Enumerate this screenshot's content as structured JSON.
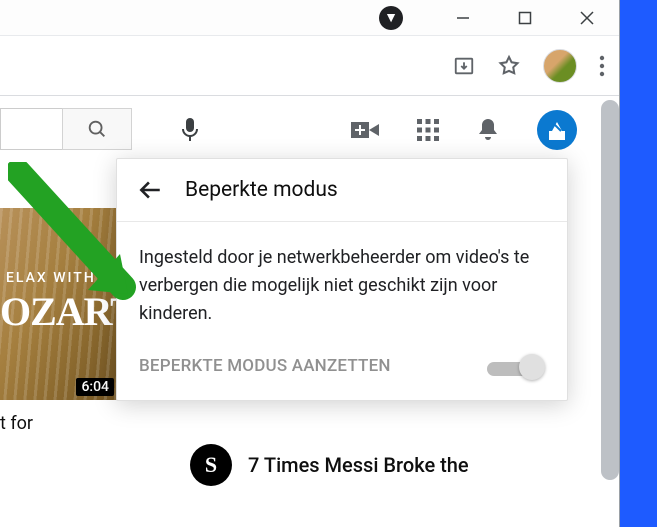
{
  "titlebar": {
    "badge": "▼"
  },
  "popover": {
    "title": "Beperkte modus",
    "description": "Ingesteld door je netwerkbeheerder om video's te verbergen die mogelijk niet geschikt zijn voor kinderen.",
    "toggle_label": "BEPERKTE MODUS AANZETTEN"
  },
  "thumbnail": {
    "line1": "ELAX WITH",
    "line2": "OZART",
    "duration": "6:04",
    "title": "t for"
  },
  "feed": {
    "avatar_letter": "S",
    "title": "7 Times Messi Broke the"
  }
}
